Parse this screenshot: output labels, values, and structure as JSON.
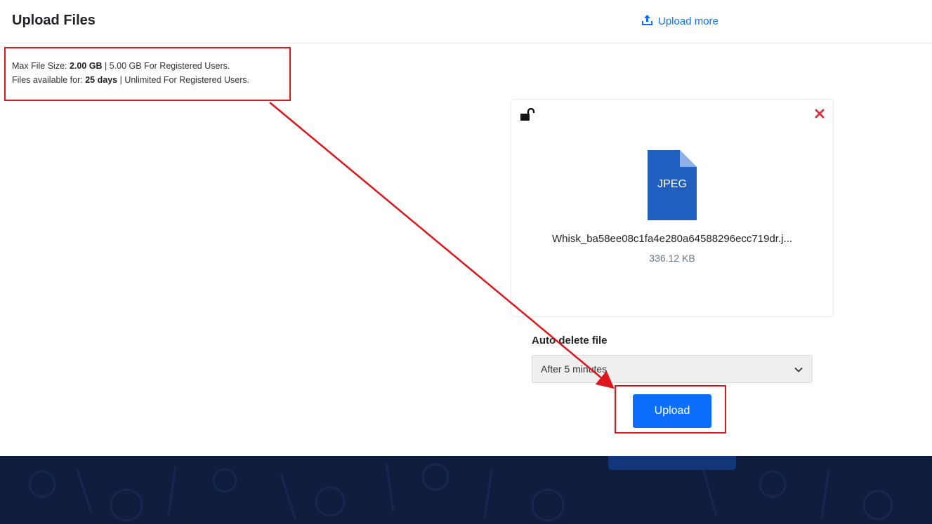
{
  "header": {
    "title": "Upload Files",
    "upload_more_label": "Upload more",
    "upload_more_icon": "upload-icon"
  },
  "info": {
    "max_size_label": "Max File Size:",
    "max_size_value": "2.00 GB",
    "max_size_registered": "| 5.00 GB For Registered Users.",
    "availability_label": "Files available for:",
    "availability_value": "25 days",
    "availability_registered": "| Unlimited For Registered Users."
  },
  "file": {
    "extension": "JPEG",
    "name": "Whisk_ba58ee08c1fa4e280a64588296ecc719dr.j...",
    "size": "336.12 KB",
    "lock_icon": "unlock-icon",
    "remove_icon": "close-icon"
  },
  "auto_delete": {
    "label": "Auto delete file",
    "selected": "After 5 minutes"
  },
  "actions": {
    "upload_label": "Upload"
  },
  "colors": {
    "primary": "#0d6efd",
    "annotation": "#e0151b",
    "footer": "#0f1d3f",
    "file_icon": "#1e5fbf"
  }
}
